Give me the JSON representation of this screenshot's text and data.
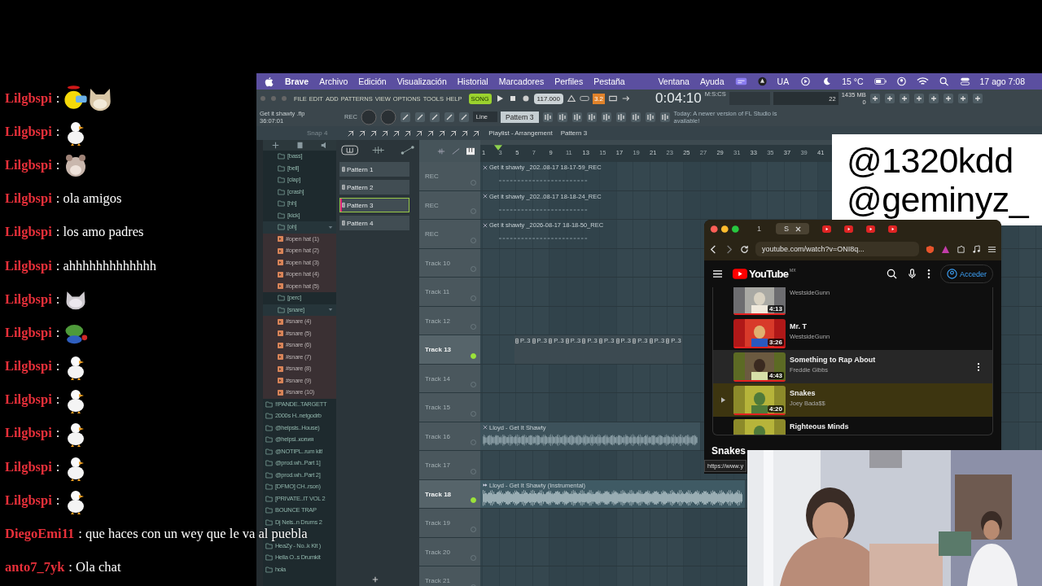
{
  "chat": [
    {
      "user": "Lilgbspi",
      "text": ":",
      "kind": "combo"
    },
    {
      "user": "Lilgbspi",
      "text": ":",
      "kind": "duck"
    },
    {
      "user": "Lilgbspi",
      "text": ":",
      "kind": "hamster"
    },
    {
      "user": "Lilgbspi",
      "text": ": ola amigos",
      "kind": "text"
    },
    {
      "user": "Lilgbspi",
      "text": ": los amo padres",
      "kind": "text"
    },
    {
      "user": "Lilgbspi",
      "text": ": ahhhhhhhhhhhhh",
      "kind": "text"
    },
    {
      "user": "Lilgbspi",
      "text": ":",
      "kind": "cat"
    },
    {
      "user": "Lilgbspi",
      "text": ":",
      "kind": "frog"
    },
    {
      "user": "Lilgbspi",
      "text": ":",
      "kind": "duck"
    },
    {
      "user": "Lilgbspi",
      "text": ":",
      "kind": "duck"
    },
    {
      "user": "Lilgbspi",
      "text": ":",
      "kind": "duck"
    },
    {
      "user": "Lilgbspi",
      "text": ":",
      "kind": "duck"
    },
    {
      "user": "Lilgbspi",
      "text": ":",
      "kind": "duck"
    },
    {
      "user": "DiegoEmi11",
      "text": ": que haces con un wey que le va al puebla",
      "kind": "text"
    },
    {
      "user": "anto7_7yk",
      "text": ": Ola chat",
      "kind": "text"
    }
  ],
  "menubar": {
    "app": "Brave",
    "menus": [
      "Archivo",
      "Edición",
      "Visualización",
      "Historial",
      "Marcadores",
      "Perfiles",
      "Pestaña"
    ],
    "right_menus": [
      "Ventana",
      "Ayuda"
    ],
    "input_source": "UA",
    "weather": "15 °C",
    "clock": "17 ago 7:08"
  },
  "fl_toolbar": {
    "menus": [
      "FILE",
      "EDIT",
      "ADD",
      "PATTERNS",
      "VIEW",
      "OPTIONS",
      "TOOLS",
      "HELP"
    ],
    "mode": "SONG",
    "tempo": "117.000",
    "snap_value": "3.2",
    "time": "0:04:10",
    "time_unit": "M:S:CS",
    "cpu": "22",
    "memory": "1435 MB",
    "polyphony": "0",
    "project": "Get it shawty .flp",
    "project_time": "36:07:01",
    "rec": "REC",
    "tool_mode": "Line",
    "pattern": "Pattern 3",
    "news": "Today: A newer version of FL Studio is available!"
  },
  "toolbar2": {
    "snap": "Snap 4",
    "title": "Playlist - Arrangement",
    "pattern": "Pattern 3"
  },
  "browser": {
    "folders": [
      {
        "label": "[bass]",
        "expanded": false
      },
      {
        "label": "[bell]",
        "expanded": false
      },
      {
        "label": "[clap]",
        "expanded": false
      },
      {
        "label": "[crash]",
        "expanded": false
      },
      {
        "label": "[hh]",
        "expanded": false
      },
      {
        "label": "[kick]",
        "expanded": false
      },
      {
        "label": "[oh]",
        "expanded": true,
        "children": [
          {
            "label": "#open hat (1)"
          },
          {
            "label": "#open hat (2)"
          },
          {
            "label": "#open hat (3)"
          },
          {
            "label": "#open hat (4)"
          },
          {
            "label": "#open hat (5)"
          }
        ]
      },
      {
        "label": "[perc]",
        "expanded": false
      },
      {
        "label": "[snare]",
        "expanded": true,
        "children": [
          {
            "label": "#snare (4)"
          },
          {
            "label": "#snare (5)"
          },
          {
            "label": "#snare (6)"
          },
          {
            "label": "#snare (7)"
          },
          {
            "label": "#snare (8)"
          },
          {
            "label": "#snare (9)"
          },
          {
            "label": "#snare (10)"
          }
        ]
      }
    ],
    "packs": [
      {
        "label": "!!PANDE..TARGETT"
      },
      {
        "label": "2000s H..netgodrb"
      },
      {
        "label": "@helpsis..House)"
      },
      {
        "label": "@helpsi..копия"
      },
      {
        "label": "@NOTIPL..rum kit!"
      },
      {
        "label": "@prod.wh..Part 1]"
      },
      {
        "label": "@prod.wh..Part 2]"
      },
      {
        "label": "[DFMO] CH..rson)"
      },
      {
        "label": "[PRIVATE..IT VOL 2"
      },
      {
        "label": "BOUNCE TRAP"
      },
      {
        "label": "Dj Nels..n Drums 2"
      },
      {
        "kind": "covered"
      },
      {
        "label": "HeaZy - No..k Kit )"
      },
      {
        "label": "Hella O..s Drumkit"
      },
      {
        "label": "hola"
      }
    ]
  },
  "patterns": [
    {
      "label": "Pattern 1",
      "selected": false
    },
    {
      "label": "Pattern 2",
      "selected": false
    },
    {
      "label": "Pattern 3",
      "selected": true
    },
    {
      "label": "Pattern 4",
      "selected": false
    }
  ],
  "playlist": {
    "ruler": [
      "1",
      "3",
      "5",
      "7",
      "9",
      "11",
      "13",
      "15",
      "17",
      "19",
      "21",
      "23",
      "25",
      "27",
      "29",
      "31",
      "33",
      "35",
      "37",
      "39",
      "41"
    ],
    "tracks": [
      {
        "name": "REC",
        "active": false,
        "clips": [
          {
            "kind": "recording",
            "label": "Get it shawty _202..08-17 18-17-59_REC"
          }
        ]
      },
      {
        "name": "REC",
        "active": false,
        "clips": [
          {
            "kind": "recording",
            "label": "Get it shawty _202..08-17 18-18-24_REC"
          }
        ]
      },
      {
        "name": "REC",
        "active": false,
        "clips": [
          {
            "kind": "recording",
            "label": "Get it shawty _2026-08-17 18-18-50_REC"
          }
        ]
      },
      {
        "name": "Track 10",
        "active": false
      },
      {
        "name": "Track 11",
        "active": false
      },
      {
        "name": "Track 12",
        "active": false
      },
      {
        "name": "Track 13",
        "active": true,
        "clips": [
          {
            "kind": "pattern",
            "label": "P..3"
          },
          {
            "kind": "pattern",
            "label": "P..3"
          },
          {
            "kind": "pattern",
            "label": "P..3"
          },
          {
            "kind": "pattern",
            "label": "P..3"
          },
          {
            "kind": "pattern",
            "label": "P..3"
          },
          {
            "kind": "pattern",
            "label": "P..3"
          },
          {
            "kind": "pattern",
            "label": "P..3"
          },
          {
            "kind": "pattern",
            "label": "P..3"
          },
          {
            "kind": "pattern",
            "label": "P..3"
          },
          {
            "kind": "pattern",
            "label": "P..3"
          }
        ]
      },
      {
        "name": "Track 14",
        "active": false
      },
      {
        "name": "Track 15",
        "active": false
      },
      {
        "name": "Track 16",
        "active": false,
        "clips": [
          {
            "kind": "audio",
            "label": "Lloyd - Get It Shawty"
          }
        ]
      },
      {
        "name": "Track 17",
        "active": false
      },
      {
        "name": "Track 18",
        "active": true,
        "clips": [
          {
            "kind": "instrumental",
            "label": "Lloyd - Get It Shawty (Instrumental)"
          }
        ]
      },
      {
        "name": "Track 19",
        "active": false
      },
      {
        "name": "Track 20",
        "active": false
      },
      {
        "name": "Track 21",
        "active": false
      }
    ]
  },
  "handles": [
    "@1320kdd",
    "@geminyz_"
  ],
  "youtube": {
    "tabs": [
      {
        "label": "1",
        "selected": false
      },
      {
        "label": "S",
        "selected": true
      }
    ],
    "url": "youtube.com/watch?v=ONI8q...",
    "logo": "YouTube",
    "region": "MX",
    "sign_in": "Acceder",
    "items": [
      {
        "channel": "WestsideGunn",
        "duration": "4:13",
        "hovered": false,
        "playing": false
      },
      {
        "title": "Mr. T",
        "channel": "WestsideGunn",
        "duration": "3:26",
        "hovered": false,
        "playing": false
      },
      {
        "title": "Something to Rap About",
        "channel": "Freddie Gibbs",
        "duration": "4:43",
        "hovered": true,
        "playing": false
      },
      {
        "title": "Snakes",
        "channel": "Joey Bada$$",
        "duration": "4:20",
        "hovered": false,
        "playing": true
      },
      {
        "title": "Righteous Minds",
        "hovered": false,
        "playing": false
      }
    ],
    "now_playing": "Snakes",
    "status_url": "https://www.y"
  }
}
